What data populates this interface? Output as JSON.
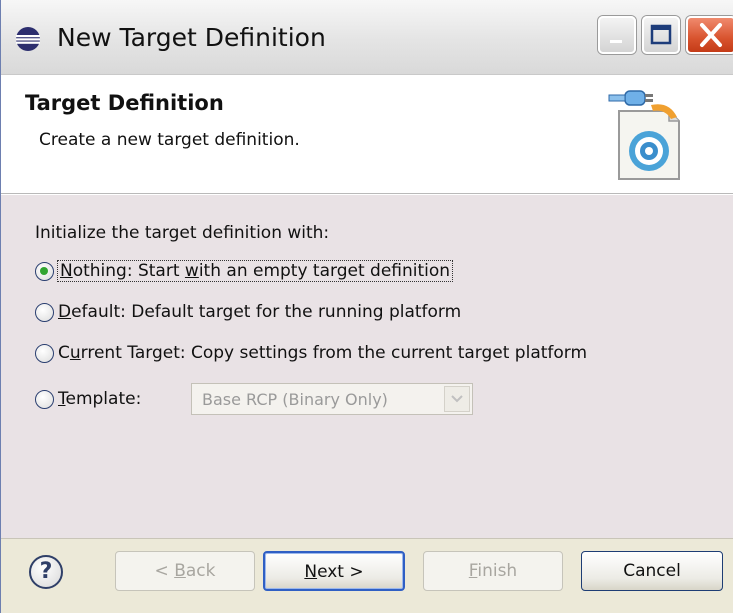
{
  "window": {
    "title": "New Target Definition"
  },
  "header": {
    "title": "Target Definition",
    "subtitle": "Create a new target definition."
  },
  "body": {
    "init_label": "Initialize the target definition with:",
    "options": [
      {
        "pre": "",
        "ul": "N",
        "post": "othing: Start ",
        "ul2": "w",
        "post2": "ith an empty target definition",
        "checked": true
      },
      {
        "pre": "",
        "ul": "D",
        "post": "efault: Default target for the running platform",
        "checked": false
      },
      {
        "pre": "C",
        "ul": "u",
        "post": "rrent Target: Copy settings from the current target platform",
        "checked": false
      },
      {
        "pre": "",
        "ul": "T",
        "post": "emplate:",
        "checked": false
      }
    ],
    "template_select": {
      "value": "Base RCP (Binary Only)",
      "enabled": false
    }
  },
  "footer": {
    "back": {
      "pre": "< ",
      "ul": "B",
      "post": "ack"
    },
    "next": {
      "ul": "N",
      "post": "ext >"
    },
    "finish": {
      "ul": "F",
      "post": "inish"
    },
    "cancel": "Cancel"
  },
  "colors": {
    "body_bg": "#e9e2e5",
    "radio_dot": "#31a531",
    "close_button": "#d8532e",
    "default_button_border": "#2f5fc4"
  },
  "icons": [
    "eclipse-icon",
    "minimize-icon",
    "maximize-icon",
    "close-icon",
    "target-definition-wizard-icon",
    "help-icon",
    "chevron-down-icon"
  ]
}
